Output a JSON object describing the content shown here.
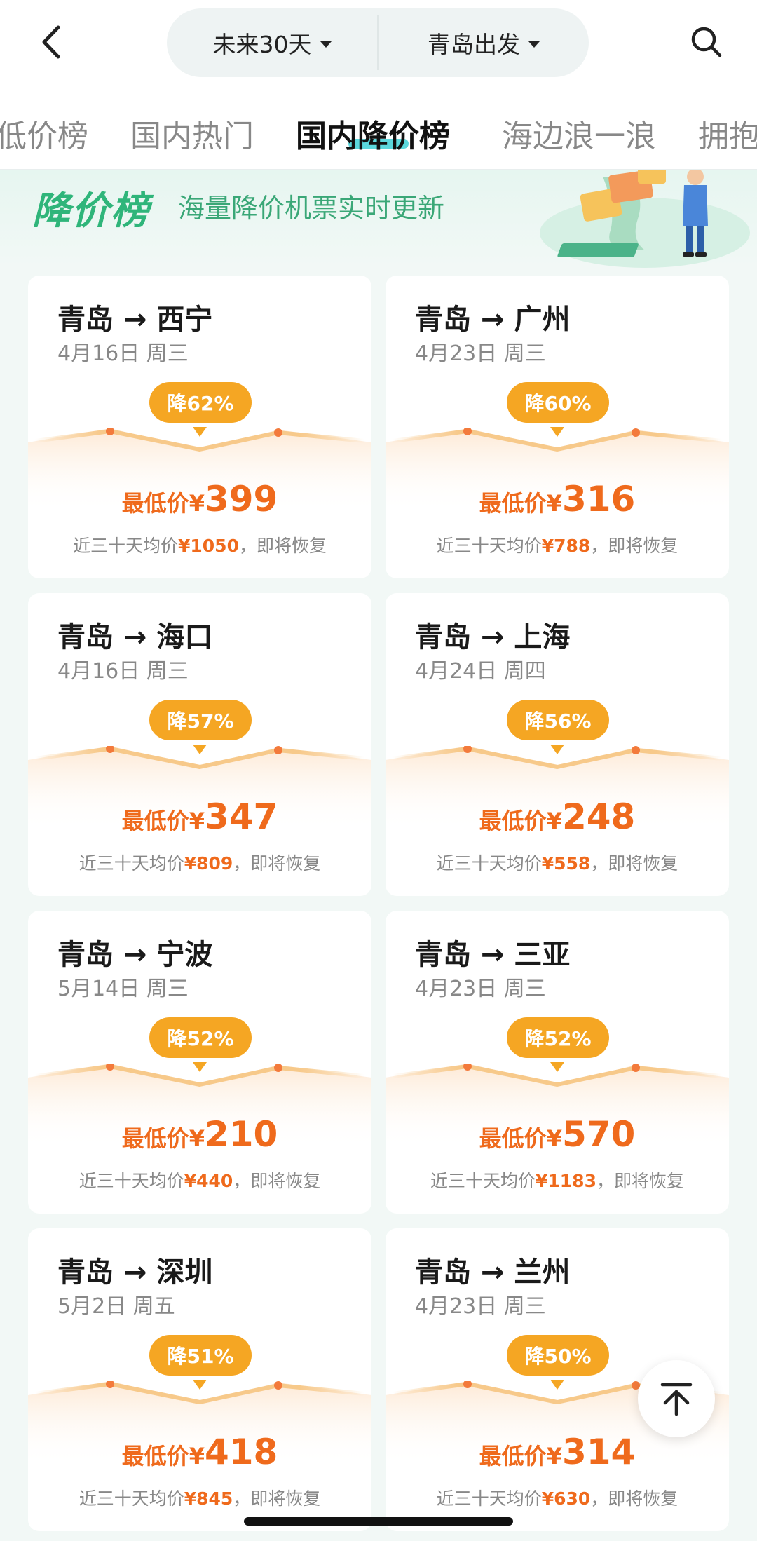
{
  "header": {
    "date_filter": "未来30天",
    "origin_filter": "青岛出发"
  },
  "tabs": [
    {
      "label": "低价榜",
      "active": false
    },
    {
      "label": "国内热门",
      "active": false
    },
    {
      "label": "国内降价榜",
      "active": true
    },
    {
      "label": "海边浪一浪",
      "active": false
    },
    {
      "label": "拥抱",
      "active": false
    }
  ],
  "banner": {
    "title": "降价榜",
    "subtitle": "海量降价机票实时更新"
  },
  "labels": {
    "lowest_price": "最低价",
    "currency": "¥",
    "avg_prefix": "近三十天均价",
    "avg_suffix": "，即将恢复"
  },
  "colors": {
    "accent_orange": "#ef6a1c",
    "badge_orange": "#f5a623",
    "brand_green": "#2fb57a",
    "tab_underline": "#3fd0d6"
  },
  "cards": [
    {
      "route": "青岛 → 西宁",
      "date": "4月16日 周三",
      "badge": "降62%",
      "price": "399",
      "avg_price": "¥1050"
    },
    {
      "route": "青岛 → 广州",
      "date": "4月23日 周三",
      "badge": "降60%",
      "price": "316",
      "avg_price": "¥788"
    },
    {
      "route": "青岛 → 海口",
      "date": "4月16日 周三",
      "badge": "降57%",
      "price": "347",
      "avg_price": "¥809"
    },
    {
      "route": "青岛 → 上海",
      "date": "4月24日 周四",
      "badge": "降56%",
      "price": "248",
      "avg_price": "¥558"
    },
    {
      "route": "青岛 → 宁波",
      "date": "5月14日 周三",
      "badge": "降52%",
      "price": "210",
      "avg_price": "¥440"
    },
    {
      "route": "青岛 → 三亚",
      "date": "4月23日 周三",
      "badge": "降52%",
      "price": "570",
      "avg_price": "¥1183"
    },
    {
      "route": "青岛 → 深圳",
      "date": "5月2日 周五",
      "badge": "降51%",
      "price": "418",
      "avg_price": "¥845"
    },
    {
      "route": "青岛 → 兰州",
      "date": "4月23日 周三",
      "badge": "降50%",
      "price": "314",
      "avg_price": "¥630"
    }
  ]
}
